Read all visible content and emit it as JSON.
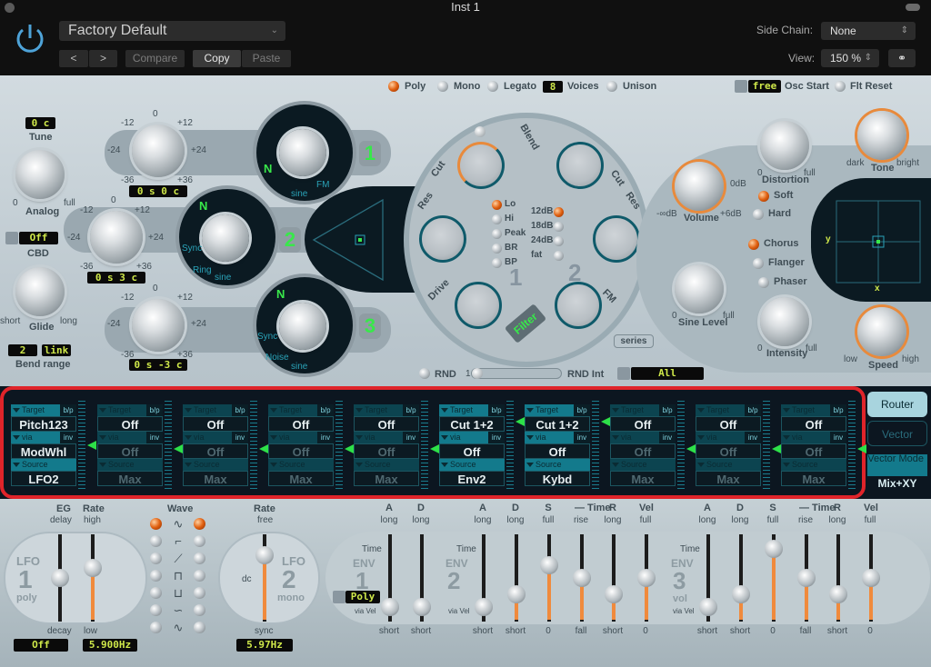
{
  "window": {
    "title": "Inst 1"
  },
  "header": {
    "preset": "Factory Default",
    "prev_label": "<",
    "next_label": ">",
    "compare_label": "Compare",
    "copy_label": "Copy",
    "paste_label": "Paste",
    "side_chain_label": "Side Chain:",
    "side_chain_value": "None",
    "view_label": "View:",
    "view_value": "150 %"
  },
  "voice_mode": {
    "options": [
      "Poly",
      "Mono",
      "Legato"
    ],
    "selected": "Poly",
    "voices_value": "8",
    "voices_label": "Voices",
    "unison_label": "Unison",
    "osc_start_value": "free",
    "osc_start_label": "Osc Start",
    "flt_reset_label": "Flt Reset"
  },
  "global": {
    "tune_value": "0 c",
    "tune_label": "Tune",
    "analog_label": "Analog",
    "analog_min": "0",
    "analog_max": "full",
    "cbd_value": "Off",
    "cbd_label": "CBD",
    "glide_label": "Glide",
    "glide_min": "short",
    "glide_max": "long",
    "bend_up": "2",
    "bend_down": "link",
    "bend_label": "Bend range"
  },
  "oscillators": [
    {
      "number": "1",
      "tune_value": "0 s   0 c",
      "wave_labels": [
        "sine",
        "FM"
      ]
    },
    {
      "number": "2",
      "tune_value": "0 s   3 c",
      "wave_labels": [
        "Sync",
        "Ring",
        "sine"
      ]
    },
    {
      "number": "3",
      "tune_value": "0 s  -3 c",
      "wave_labels": [
        "Sync",
        "Noise",
        "sine"
      ]
    }
  ],
  "pitch_scale": {
    "zero": "0",
    "m12": "-12",
    "p12": "+12",
    "m24": "-24",
    "p24": "+24",
    "m36": "-36",
    "p36": "+36"
  },
  "filter": {
    "blend_label": "Blend",
    "cut_label": "Cut",
    "res_label": "Res",
    "drive_label": "Drive",
    "fm_label": "FM",
    "filter_button": "Filter",
    "series_label": "series",
    "filter1_types": [
      "Lo",
      "Hi",
      "Peak",
      "BR",
      "BP"
    ],
    "filter1_selected": "Lo",
    "filter2_slopes": [
      "12dB",
      "18dB",
      "24dB",
      "fat"
    ],
    "filter2_selected": "12dB",
    "filter1_number": "1",
    "filter2_number": "2"
  },
  "rnd": {
    "label": "RND",
    "slider_min": "1",
    "int_label": "RND Int",
    "target_value": "All"
  },
  "output": {
    "volume_label": "Volume",
    "volume_min": "-∞dB",
    "volume_mid": "0dB",
    "volume_max": "+6dB",
    "sine_label": "Sine Level",
    "sine_min": "0",
    "sine_max": "full",
    "distortion_label": "Distortion",
    "distortion_min": "0",
    "distortion_max": "full",
    "dist_modes": [
      "Soft",
      "Hard"
    ],
    "dist_selected": "Soft",
    "tone_label": "Tone",
    "tone_min": "dark",
    "tone_max": "bright",
    "fx_modes": [
      "Chorus",
      "Flanger",
      "Phaser"
    ],
    "fx_selected": "Chorus",
    "intensity_label": "Intensity",
    "intensity_min": "0",
    "intensity_max": "full",
    "speed_label": "Speed",
    "speed_min": "low",
    "speed_max": "high",
    "xy_x": "x",
    "xy_y": "y"
  },
  "router": {
    "target_label": "Target",
    "via_label": "via",
    "source_label": "Source",
    "bp_label": "b/p",
    "inv_label": "inv",
    "slots": [
      {
        "target": "Pitch123",
        "via": "ModWhl",
        "source": "LFO2",
        "active": true
      },
      {
        "target": "Off",
        "via": "Off",
        "source": "Max",
        "active": false
      },
      {
        "target": "Off",
        "via": "Off",
        "source": "Max",
        "active": false
      },
      {
        "target": "Off",
        "via": "Off",
        "source": "Max",
        "active": false
      },
      {
        "target": "Off",
        "via": "Off",
        "source": "Max",
        "active": false
      },
      {
        "target": "Cut 1+2",
        "via": "Off",
        "source": "Env2",
        "active": true
      },
      {
        "target": "Cut 1+2",
        "via": "Off",
        "source": "Kybd",
        "active": true
      },
      {
        "target": "Off",
        "via": "Off",
        "source": "Max",
        "active": false
      },
      {
        "target": "Off",
        "via": "Off",
        "source": "Max",
        "active": false
      },
      {
        "target": "Off",
        "via": "Off",
        "source": "Max",
        "active": false
      }
    ],
    "router_tab": "Router",
    "vector_tab": "Vector",
    "vector_mode_label": "Vector Mode",
    "vector_mode_value": "Mix+XY"
  },
  "lfo": {
    "eg_label": "EG",
    "eg_top": "delay",
    "eg_bottom": "decay",
    "rate1_label": "Rate",
    "rate1_top": "high",
    "rate1_bottom": "low",
    "lfo1_title": "LFO",
    "lfo1_number": "1",
    "lfo1_mode": "poly",
    "lfo1_eg_value": "Off",
    "lfo1_rate_value": "5.900Hz",
    "wave_label": "Wave",
    "wave_left_selected": 0,
    "wave_right_selected": 0,
    "rate2_label": "Rate",
    "rate2_top": "free",
    "rate2_bottom": "sync",
    "rate2_dc": "dc",
    "lfo2_title": "LFO",
    "lfo2_number": "2",
    "lfo2_mode": "mono",
    "lfo2_rate_value": "5.97Hz",
    "lfo1_rate_level": 0.65,
    "lfo1_eg_level": 0.5,
    "lfo2_rate_level": 0.85
  },
  "envelopes": {
    "env1": {
      "title": "ENV",
      "number": "1",
      "mode": "Poly",
      "time_label": "Time",
      "via_label": "via Vel",
      "sliders": [
        {
          "name": "A",
          "top": "long",
          "bottom": "short",
          "level": 0.05
        },
        {
          "name": "D",
          "top": "long",
          "bottom": "short",
          "level": 0.05
        }
      ]
    },
    "env2": {
      "title": "ENV",
      "number": "2",
      "time_label": "Time",
      "via_label": "via Vel",
      "sliders": [
        {
          "name": "A",
          "top": "long",
          "bottom": "short",
          "level": 0.05
        },
        {
          "name": "D",
          "top": "long",
          "bottom": "short",
          "level": 0.25
        },
        {
          "name": "S",
          "top": "full",
          "bottom": "0",
          "level": 0.7
        },
        {
          "name": "— Time",
          "top": "rise",
          "bottom": "fall",
          "level": 0.5
        },
        {
          "name": "R",
          "top": "long",
          "bottom": "short",
          "level": 0.25
        },
        {
          "name": "Vel",
          "top": "full",
          "bottom": "0",
          "level": 0.5
        }
      ]
    },
    "env3": {
      "title": "ENV",
      "number": "3",
      "mode": "vol",
      "time_label": "Time",
      "via_label": "via Vel",
      "sliders": [
        {
          "name": "A",
          "top": "long",
          "bottom": "short",
          "level": 0.05
        },
        {
          "name": "D",
          "top": "long",
          "bottom": "short",
          "level": 0.25
        },
        {
          "name": "S",
          "top": "full",
          "bottom": "0",
          "level": 0.95
        },
        {
          "name": "— Time",
          "top": "rise",
          "bottom": "fall",
          "level": 0.5
        },
        {
          "name": "R",
          "top": "long",
          "bottom": "short",
          "level": 0.25
        },
        {
          "name": "Vel",
          "top": "full",
          "bottom": "0",
          "level": 0.5
        }
      ]
    }
  }
}
